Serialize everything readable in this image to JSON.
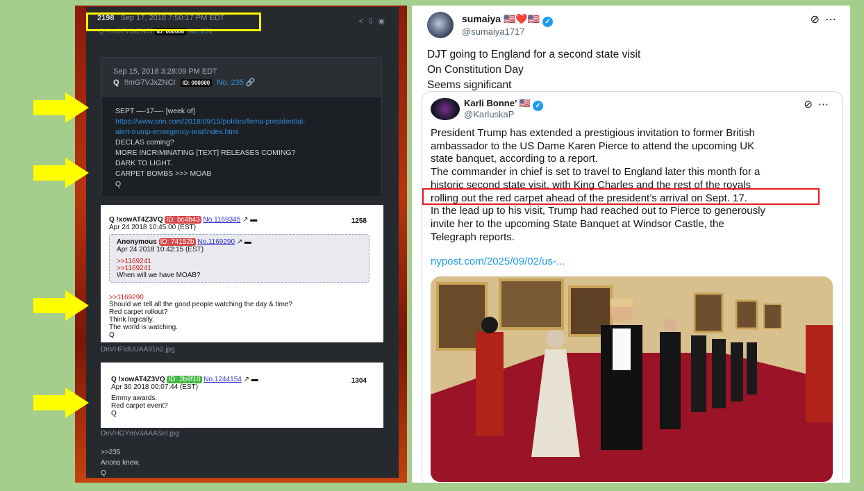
{
  "left": {
    "post_number": "2198",
    "post_timestamp": "Sep 17, 2018 7:50:17 PM EDT",
    "post_sub_author": "Q",
    "post_sub_trip": "!!mG7VJxZNCI",
    "post_sub_id": "ID: 000000",
    "post_sub_no": "No. 251",
    "quote_timestamp": "Sep 15, 2018 3:28:09 PM EDT",
    "quote_author": "Q",
    "quote_trip": "!!mG7VJxZNCI",
    "quote_id": "ID: 000000",
    "quote_no": "No. 235",
    "quote_lines": {
      "l1": "SEPT —-17—- [week of]",
      "url1": "https://www.cnn.com/2018/09/15/politics/fema-presidential-",
      "url2": "alert-trump-emergency-test/index.html",
      "l3": "DECLAS coming?",
      "l4": "MORE INCRIMINATING [TEXT] RELEASES COMING?",
      "l5": "DARK TO LIGHT.",
      "l6": "CARPET BOMBS >>> MOAB",
      "l7": "Q"
    },
    "card1": {
      "header": "Q !xowAT4Z3VQ",
      "id": "ID: bc4b43",
      "no": "No.1169345",
      "count": "1258",
      "date": "Apr 24 2018 10:45:00 (EST)",
      "inner_author": "Anonymous",
      "inner_id": "ID: 74152b",
      "inner_no": "No.1169290",
      "inner_date": "Apr 24 2018 10:42:15 (EST)",
      "inner_ref1": ">>1169241",
      "inner_ref2": ">>1169241",
      "inner_text": "When will we have MOAB?",
      "ref": ">>1169290",
      "lines": [
        "Should we tell all the good people watching the day & time?",
        "Red carpet rollout?",
        "Think logically.",
        "The world is watching.",
        "Q"
      ]
    },
    "file1": "DnVHFidUUAA91n2.jpg",
    "card2": {
      "header": "Q !xowAT4Z3VQ",
      "id": "ID: 2b9f10",
      "no": "No.1244154",
      "count": "1304",
      "date": "Apr 30 2018 00:07:44 (EST)",
      "lines": [
        "Emmy awards.",
        "Red carpet event?",
        "Q"
      ]
    },
    "file2": "DnVHGYmV4AAASeI.jpg",
    "footer": {
      "ref": ">>235",
      "line1": "Anons knew.",
      "line2": "Q"
    }
  },
  "tweet": {
    "author_name": "sumaiya",
    "author_flags": "🇺🇸❤️🇺🇸",
    "author_handle": "@sumaiya1717",
    "text_lines": [
      "DJT going to England for a second state visit",
      "On Constitution Day",
      "Seems significant"
    ],
    "quoted": {
      "author_name": "Karli Bonne’",
      "author_flag": "🇺🇸",
      "author_handle": "@KarluskaP",
      "lines": [
        "President Trump has extended a prestigious invitation to former British",
        "ambassador to the US Dame Karen Pierce to attend the upcoming UK",
        "state banquet, according to a report.",
        "The commander in chief is set to travel to England later this month for a",
        "historic second state visit, with King Charles and the rest of the royals",
        "rolling out the red carpet ahead of the president’s arrival on Sept. 17.",
        "In the lead up to his visit, Trump had reached out to Pierce to generously",
        "invite her to the upcoming State Banquet at Windsor Castle, the",
        "Telegraph reports."
      ],
      "link": "nypost.com/2025/09/02/us-..."
    }
  },
  "colors": {
    "highlight_yellow": "#ffff00",
    "highlight_red": "#e8191b",
    "page_green": "#a5cd8c",
    "twitter_blue": "#1d9bf0"
  },
  "icons": [
    "share-icon",
    "download-icon",
    "eye-icon",
    "link-icon",
    "external-link-icon",
    "folder-icon",
    "verified-icon",
    "grok-icon",
    "more-icon",
    "arrow-icon"
  ]
}
